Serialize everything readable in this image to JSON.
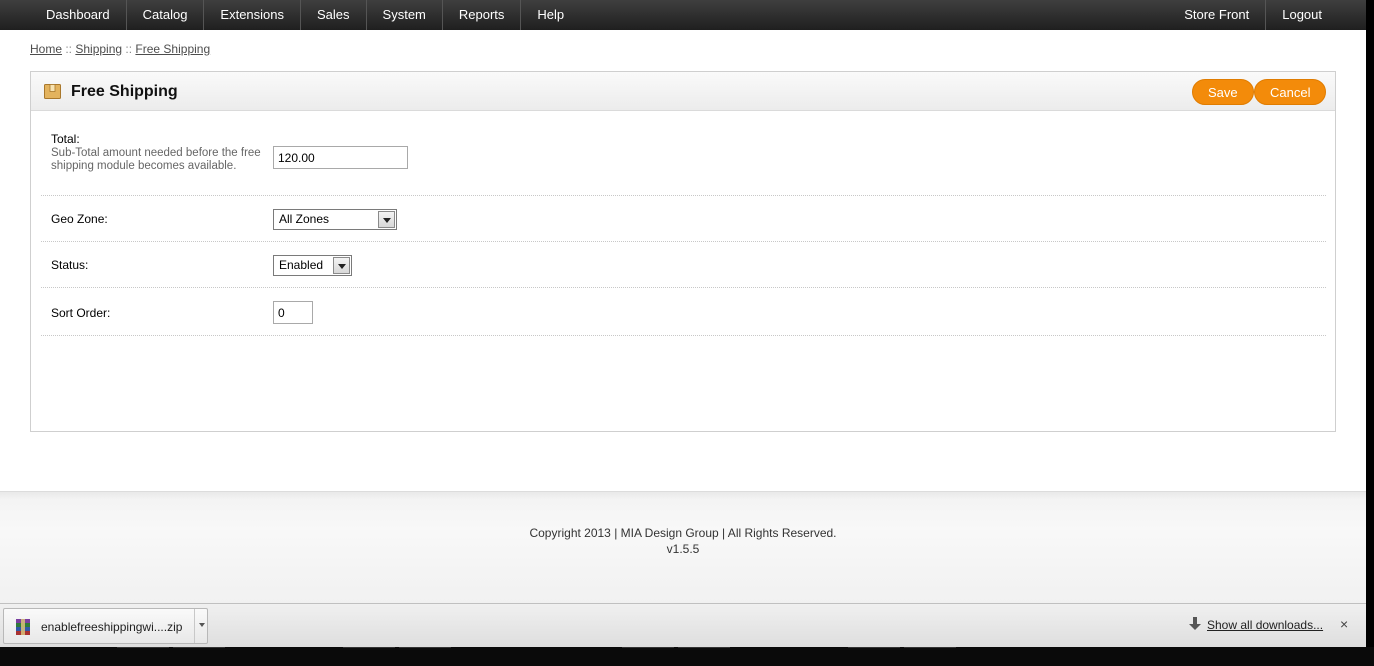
{
  "menu": {
    "left": [
      "Dashboard",
      "Catalog",
      "Extensions",
      "Sales",
      "System",
      "Reports",
      "Help"
    ],
    "right": [
      "Store Front",
      "Logout"
    ]
  },
  "breadcrumb": {
    "home": "Home",
    "sep": " :: ",
    "shipping": "Shipping",
    "current": "Free Shipping"
  },
  "box": {
    "title": "Free Shipping",
    "icon": "shipping-box-icon",
    "save_label": "Save",
    "cancel_label": "Cancel"
  },
  "form": {
    "total": {
      "label": "Total:",
      "help": "Sub-Total amount needed before the free shipping module becomes available.",
      "value": "120.00"
    },
    "geo_zone": {
      "label": "Geo Zone:",
      "value": "All Zones"
    },
    "status": {
      "label": "Status:",
      "value": "Enabled"
    },
    "sort_order": {
      "label": "Sort Order:",
      "value": "0"
    }
  },
  "footer": {
    "copyright": "Copyright 2013 | MIA Design Group | All Rights Reserved.",
    "version": "v1.5.5"
  },
  "downloads": {
    "file_name": "enablefreeshippingwi....zip",
    "file_icon": "winrar-archive-icon",
    "show_all": "Show all downloads...",
    "close": "×"
  },
  "colors": {
    "accent": "#f38b0a",
    "menu_bg": "#2b2b2b"
  }
}
